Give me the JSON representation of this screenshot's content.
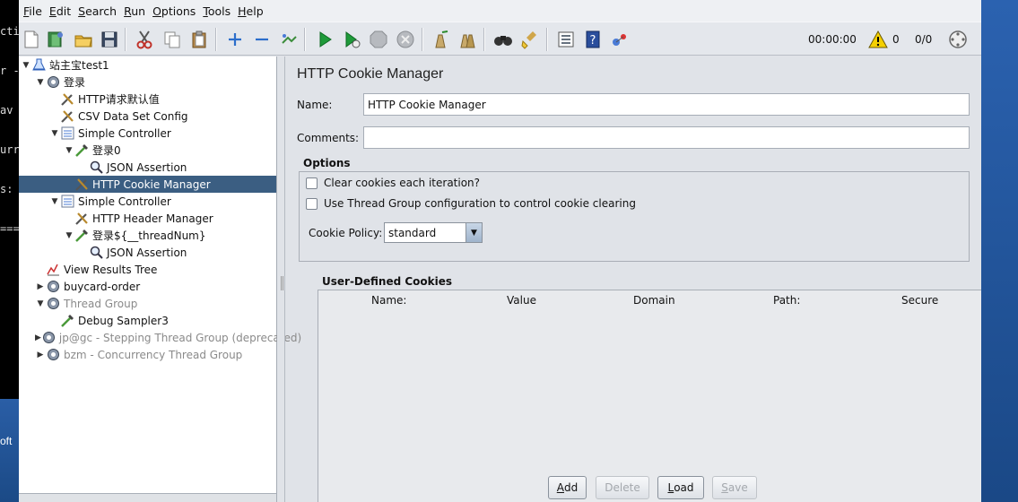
{
  "terminal": {
    "lines": [
      "cti",
      "r -",
      "av",
      "urr",
      "s:",
      "==="
    ],
    "bottom_text": "oft"
  },
  "menu": [
    {
      "label": "File",
      "mnemonic": "F",
      "rest": "ile"
    },
    {
      "label": "Edit",
      "mnemonic": "E",
      "rest": "dit"
    },
    {
      "label": "Search",
      "mnemonic": "S",
      "rest": "earch"
    },
    {
      "label": "Run",
      "mnemonic": "R",
      "rest": "un"
    },
    {
      "label": "Options",
      "mnemonic": "O",
      "rest": "ptions"
    },
    {
      "label": "Tools",
      "mnemonic": "T",
      "rest": "ools"
    },
    {
      "label": "Help",
      "mnemonic": "H",
      "rest": "elp"
    }
  ],
  "toolbar": {
    "timer": "00:00:00",
    "warning_count": "0",
    "threads": "0/0",
    "icons": [
      "new-icon",
      "templates-icon",
      "open-icon",
      "save-icon",
      "cut-icon",
      "copy-icon",
      "paste-icon",
      "expand-icon",
      "collapse-icon",
      "toggle-icon",
      "start-icon",
      "start-no-pause-icon",
      "stop-icon",
      "shutdown-icon",
      "clear-icon",
      "clear-all-icon",
      "search-icon",
      "reset-search-icon",
      "function-helper-icon",
      "help-icon",
      "remote-icon",
      "warning-icon",
      "globe-icon"
    ]
  },
  "tree": [
    {
      "label": "站主宝test1",
      "indent": 0,
      "arrow": "▼",
      "icon": "testplan-icon"
    },
    {
      "label": "登录",
      "indent": 1,
      "arrow": "▼",
      "icon": "thread-group-icon"
    },
    {
      "label": "HTTP请求默认值",
      "indent": 2,
      "arrow": "",
      "icon": "config-icon"
    },
    {
      "label": "CSV Data Set Config",
      "indent": 2,
      "arrow": "",
      "icon": "config-icon"
    },
    {
      "label": "Simple Controller",
      "indent": 2,
      "arrow": "▼",
      "icon": "controller-icon"
    },
    {
      "label": "登录0",
      "indent": 3,
      "arrow": "▼",
      "icon": "sampler-icon"
    },
    {
      "label": "JSON Assertion",
      "indent": 4,
      "arrow": "",
      "icon": "assertion-icon"
    },
    {
      "label": "HTTP Cookie Manager",
      "indent": 3,
      "arrow": "",
      "icon": "config-icon",
      "selected": true
    },
    {
      "label": "Simple Controller",
      "indent": 2,
      "arrow": "▼",
      "icon": "controller-icon"
    },
    {
      "label": "HTTP Header Manager",
      "indent": 3,
      "arrow": "",
      "icon": "config-icon"
    },
    {
      "label": "登录${__threadNum}",
      "indent": 3,
      "arrow": "▼",
      "icon": "sampler-icon"
    },
    {
      "label": "JSON Assertion",
      "indent": 4,
      "arrow": "",
      "icon": "assertion-icon"
    },
    {
      "label": "View Results Tree",
      "indent": 1,
      "arrow": "",
      "icon": "listener-icon"
    },
    {
      "label": "buycard-order",
      "indent": 1,
      "arrow": "▶",
      "icon": "thread-group-icon"
    },
    {
      "label": "Thread Group",
      "indent": 1,
      "arrow": "▼",
      "icon": "thread-group-icon",
      "disabled": true
    },
    {
      "label": "Debug Sampler3",
      "indent": 2,
      "arrow": "",
      "icon": "sampler-icon"
    },
    {
      "label": "jp@gc - Stepping Thread Group (deprecated)",
      "indent": 1,
      "arrow": "▶",
      "icon": "thread-group-icon",
      "disabled": true
    },
    {
      "label": "bzm - Concurrency Thread Group",
      "indent": 1,
      "arrow": "▶",
      "icon": "thread-group-icon",
      "disabled": true
    }
  ],
  "panel": {
    "title": "HTTP Cookie Manager",
    "name_label": "Name:",
    "name_value": "HTTP Cookie Manager",
    "comments_label": "Comments:",
    "comments_value": "",
    "options_title": "Options",
    "clear_each_iteration": "Clear cookies each iteration?",
    "use_thread_group": "Use Thread Group configuration to control cookie clearing",
    "cookie_policy_label": "Cookie Policy:",
    "cookie_policy_value": "standard",
    "user_cookies_title": "User-Defined Cookies",
    "columns": [
      "Name:",
      "Value",
      "Domain",
      "Path:",
      "Secure"
    ],
    "buttons": {
      "add": {
        "mn": "A",
        "rest": "dd"
      },
      "delete": {
        "mn": "",
        "rest": "Delete"
      },
      "load": {
        "mn": "L",
        "rest": "oad"
      },
      "save": {
        "mn": "S",
        "rest": "ave"
      }
    }
  }
}
